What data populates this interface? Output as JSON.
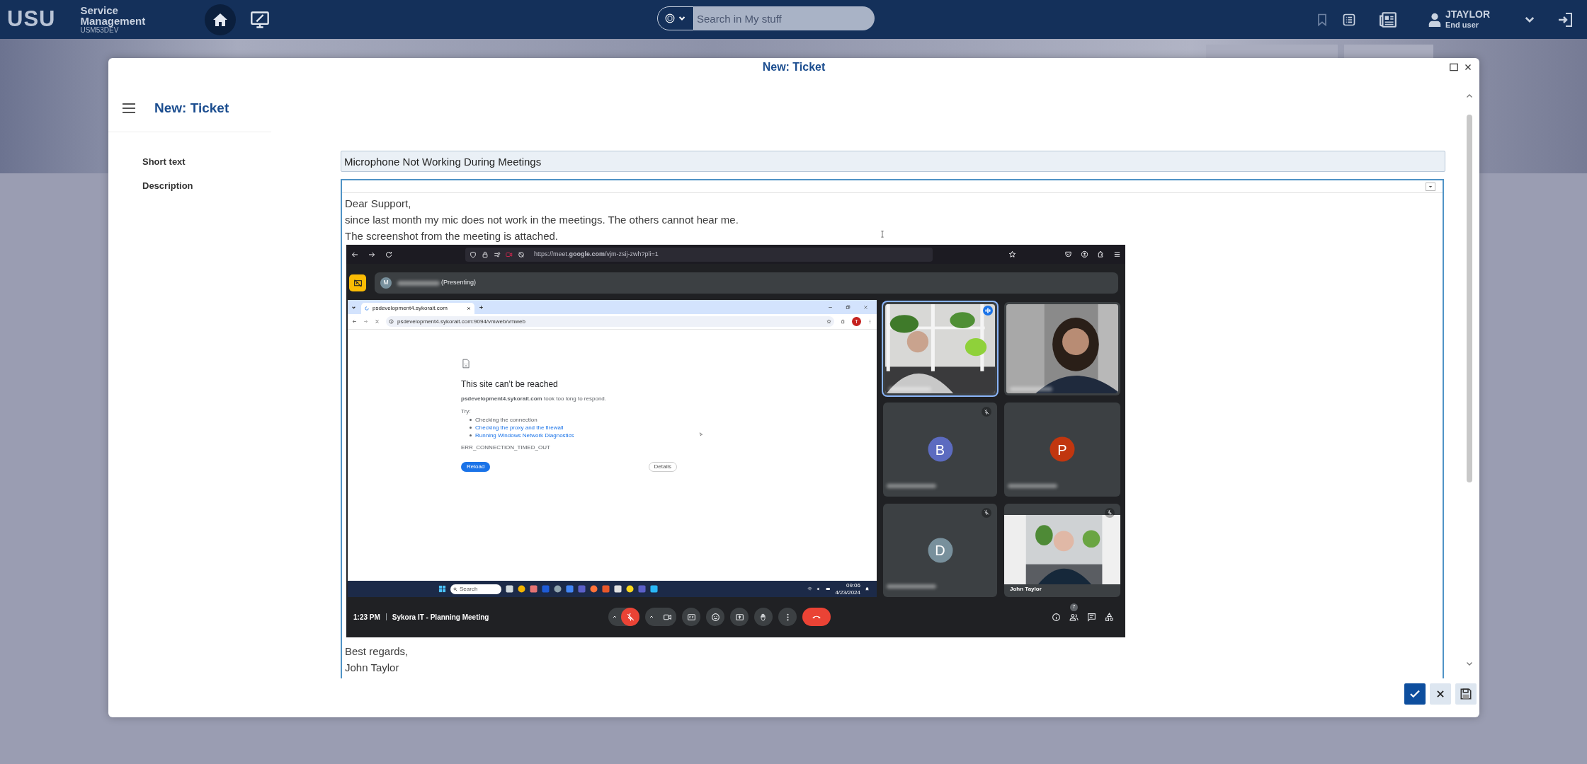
{
  "topbar": {
    "logo": "USU",
    "app_name": "Service Management",
    "instance": "USM53DEV",
    "search": {
      "placeholder": "Search in My stuff"
    },
    "user": {
      "name": "JTAYLOR",
      "role": "End user"
    }
  },
  "dialog": {
    "title": "New: Ticket",
    "heading": "New: Ticket",
    "short_text": {
      "label": "Short text",
      "value": "Microphone Not Working During Meetings"
    },
    "description": {
      "label": "Description",
      "lines_before": [
        "Dear Support,",
        "since last month my mic does not work in the meetings. The others cannot hear me.",
        "The screenshot from the meeting is attached."
      ],
      "screenshot": {
        "browser_url": "https://meet.**google.com**/vjm-zsij-zwh?pli=1",
        "presenter": {
          "initial": "M",
          "label": "(Presenting)"
        },
        "shared_window": {
          "tab_title": "psdevelopment4.sykorait.com",
          "address": "psdevelopment4.sykorait.com:9094/vmweb/vmweb",
          "profile_initial": "T",
          "error_title": "This site can’t be reached",
          "error_message": "**psdevelopment4.sykorait.com** took too long to respond.",
          "try_label": "Try:",
          "suggestions": [
            {
              "text": "Checking the connection",
              "link": false
            },
            {
              "text": "Checking the proxy and the firewall",
              "link": true
            },
            {
              "text": "Running Windows Network Diagnostics",
              "link": true
            }
          ],
          "error_code": "ERR_CONNECTION_TIMED_OUT",
          "buttons": [
            "Reload",
            "Details"
          ],
          "taskbar": {
            "search_placeholder": "Search",
            "time": "09:06",
            "date": "4/23/2024"
          }
        },
        "participants": [
          {
            "kind": "video",
            "speaking": true,
            "muted": false
          },
          {
            "kind": "video",
            "speaking": false,
            "muted": false
          },
          {
            "kind": "avatar",
            "initial": "B",
            "color": "#5c6bc0",
            "speaking": false,
            "muted": true
          },
          {
            "kind": "avatar",
            "initial": "P",
            "color": "#c1360f",
            "speaking": false,
            "muted": false
          },
          {
            "kind": "avatar",
            "initial": "D",
            "color": "#78909c",
            "speaking": false,
            "muted": true
          },
          {
            "kind": "video",
            "name": "John Taylor",
            "speaking": false,
            "muted": true
          }
        ],
        "meeting_time": "1:23 PM",
        "meeting_title": "Sykora IT - Planning Meeting",
        "mic_muted": true,
        "people_count": "7"
      },
      "lines_after": [
        "Best regards,",
        "John Taylor"
      ]
    }
  }
}
